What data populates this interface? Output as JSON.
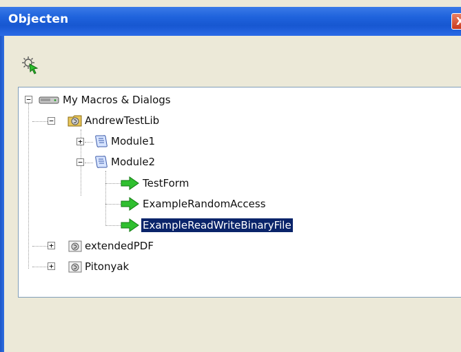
{
  "window": {
    "title": "Objecten",
    "close_glyph": "X"
  },
  "toolbar": {
    "icon": "macro-select-icon"
  },
  "tree": {
    "root": {
      "label": "My Macros & Dialogs",
      "expanded": true,
      "icon": "drive-icon"
    },
    "libraries": [
      {
        "label": "AndrewTestLib",
        "expanded": true,
        "icon": "library-icon"
      },
      {
        "label": "extendedPDF",
        "expanded": false,
        "icon": "library-icon"
      },
      {
        "label": "Pitonyak",
        "expanded": false,
        "icon": "library-icon"
      }
    ],
    "modules": [
      {
        "label": "Module1",
        "expanded": false,
        "icon": "module-icon"
      },
      {
        "label": "Module2",
        "expanded": true,
        "icon": "module-icon"
      }
    ],
    "macros": [
      {
        "label": "TestForm",
        "icon": "green-arrow-icon",
        "selected": false
      },
      {
        "label": "ExampleRandomAccess",
        "icon": "green-arrow-icon",
        "selected": false
      },
      {
        "label": "ExampleReadWriteBinaryFile",
        "icon": "green-arrow-icon",
        "selected": true
      }
    ]
  },
  "colors": {
    "titlebar": "#1f63dc",
    "selection": "#0a246a",
    "arrow": "#2fbf2f"
  }
}
